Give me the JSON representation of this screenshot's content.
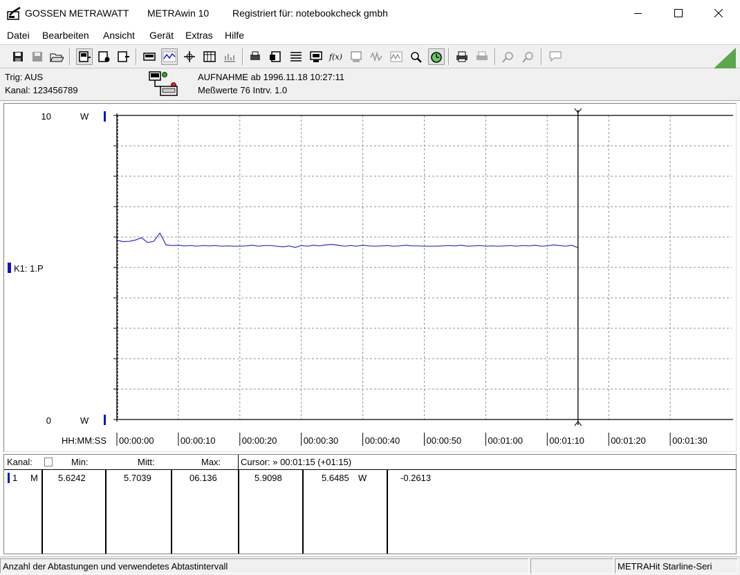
{
  "window": {
    "app_name": "GOSSEN METRAWATT",
    "product": "METRAwin 10",
    "registration": "Registriert für: notebookcheck gmbh"
  },
  "menu": {
    "datei": "Datei",
    "bearbeiten": "Bearbeiten",
    "ansicht": "Ansicht",
    "geraet": "Gerät",
    "extras": "Extras",
    "hilfe": "Hilfe"
  },
  "info": {
    "trig": "Trig: AUS",
    "kanal": "Kanal: 123456789",
    "aufnahme": "AUFNAHME ab 1996.11.18 10:27:11",
    "messwerte": "Meßwerte 76   Intrv. 1.0"
  },
  "chart_data": {
    "type": "line",
    "ylim": [
      0,
      10
    ],
    "y_top_label": "10",
    "y_bottom_label": "0",
    "y_unit": "W",
    "channel_label": "K1: 1.P",
    "x_axis_label": "HH:MM:SS",
    "x_ticks": [
      "00:00:00",
      "00:00:10",
      "00:00:20",
      "00:00:30",
      "00:00:40",
      "00:00:50",
      "00:01:00",
      "00:01:10",
      "00:01:20",
      "00:01:30"
    ],
    "x_range_seconds": [
      0,
      100
    ],
    "cursor_seconds": 75,
    "series": [
      {
        "color": "#2a2ae0",
        "x": [
          0,
          1,
          2,
          3,
          4,
          5,
          6,
          7,
          8,
          9,
          10,
          11,
          12,
          13,
          14,
          15,
          16,
          17,
          18,
          19,
          20,
          21,
          22,
          23,
          24,
          25,
          26,
          27,
          28,
          29,
          30,
          31,
          32,
          33,
          34,
          35,
          36,
          37,
          38,
          39,
          40,
          41,
          42,
          43,
          44,
          45,
          46,
          47,
          48,
          49,
          50,
          51,
          52,
          53,
          54,
          55,
          56,
          57,
          58,
          59,
          60,
          61,
          62,
          63,
          64,
          65,
          66,
          67,
          68,
          69,
          70,
          71,
          72,
          73,
          74,
          75
        ],
        "y": [
          5.9,
          5.85,
          5.86,
          5.9,
          5.98,
          5.82,
          5.86,
          6.13,
          5.74,
          5.72,
          5.73,
          5.71,
          5.72,
          5.7,
          5.72,
          5.71,
          5.72,
          5.7,
          5.71,
          5.7,
          5.7,
          5.71,
          5.73,
          5.7,
          5.72,
          5.72,
          5.7,
          5.68,
          5.71,
          5.66,
          5.72,
          5.7,
          5.73,
          5.71,
          5.74,
          5.76,
          5.73,
          5.7,
          5.72,
          5.7,
          5.73,
          5.71,
          5.7,
          5.71,
          5.72,
          5.7,
          5.71,
          5.73,
          5.71,
          5.71,
          5.7,
          5.7,
          5.7,
          5.71,
          5.72,
          5.71,
          5.73,
          5.7,
          5.71,
          5.72,
          5.7,
          5.71,
          5.7,
          5.71,
          5.72,
          5.7,
          5.72,
          5.71,
          5.73,
          5.7,
          5.71,
          5.74,
          5.72,
          5.7,
          5.73,
          5.65
        ]
      }
    ]
  },
  "table": {
    "headers": {
      "kanal": "Kanal:",
      "min": "Min:",
      "mitt": "Mitt:",
      "max": "Max:",
      "cursor": "Cursor: » 00:01:15 (+01:15)"
    },
    "row": {
      "channel": "1",
      "mode": "M",
      "min": "5.6242",
      "mitt": "5.7039",
      "max": "06.136",
      "cursor_value": "5.9098",
      "value2": "5.6485",
      "unit": "W",
      "delta": "-0.2613"
    }
  },
  "status": {
    "message": "Anzahl der Abtastungen und verwendetes Abtastintervall",
    "device": "METRAHit Starline-Seri"
  },
  "colors": {
    "series": "#2a2ae0",
    "marker": "#1010d0",
    "grip": "#5aa84a"
  }
}
